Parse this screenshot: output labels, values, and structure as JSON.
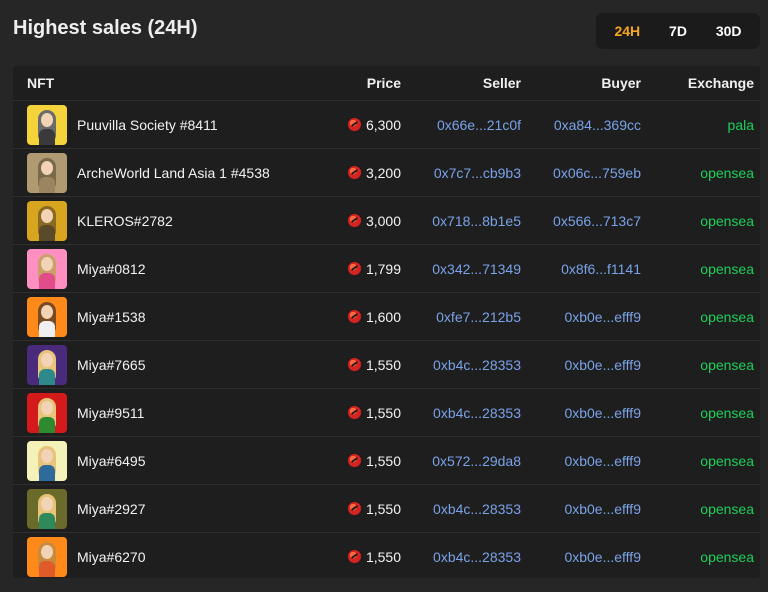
{
  "header": {
    "title": "Highest sales (24H)",
    "tabs": [
      {
        "label": "24H",
        "active": true
      },
      {
        "label": "7D",
        "active": false
      },
      {
        "label": "30D",
        "active": false
      }
    ]
  },
  "table": {
    "columns": [
      "NFT",
      "Price",
      "Seller",
      "Buyer",
      "Exchange"
    ],
    "rows": [
      {
        "nft": "Puuvilla Society #8411",
        "price": "6,300",
        "seller": "0x66e...21c0f",
        "buyer": "0xa84...369cc",
        "exchange": "pala"
      },
      {
        "nft": "ArcheWorld Land Asia 1 #4538",
        "price": "3,200",
        "seller": "0x7c7...cb9b3",
        "buyer": "0x06c...759eb",
        "exchange": "opensea"
      },
      {
        "nft": "KLEROS#2782",
        "price": "3,000",
        "seller": "0x718...8b1e5",
        "buyer": "0x566...713c7",
        "exchange": "opensea"
      },
      {
        "nft": "Miya#0812",
        "price": "1,799",
        "seller": "0x342...71349",
        "buyer": "0x8f6...f1141",
        "exchange": "opensea"
      },
      {
        "nft": "Miya#1538",
        "price": "1,600",
        "seller": "0xfe7...212b5",
        "buyer": "0xb0e...efff9",
        "exchange": "opensea"
      },
      {
        "nft": "Miya#7665",
        "price": "1,550",
        "seller": "0xb4c...28353",
        "buyer": "0xb0e...efff9",
        "exchange": "opensea"
      },
      {
        "nft": "Miya#9511",
        "price": "1,550",
        "seller": "0xb4c...28353",
        "buyer": "0xb0e...efff9",
        "exchange": "opensea"
      },
      {
        "nft": "Miya#6495",
        "price": "1,550",
        "seller": "0x572...29da8",
        "buyer": "0xb0e...efff9",
        "exchange": "opensea"
      },
      {
        "nft": "Miya#2927",
        "price": "1,550",
        "seller": "0xb4c...28353",
        "buyer": "0xb0e...efff9",
        "exchange": "opensea"
      },
      {
        "nft": "Miya#6270",
        "price": "1,550",
        "seller": "0xb4c...28353",
        "buyer": "0xb0e...efff9",
        "exchange": "opensea"
      }
    ]
  },
  "colors": {
    "active_tab": "#f6a623",
    "address": "#7aa2e8",
    "exchange": "#1fcf5c",
    "thumbs": [
      {
        "bg": "#f5d33a",
        "hair": "#6b6b6b",
        "body": "#3a3a3a"
      },
      {
        "bg": "#b09a72",
        "hair": "#7a6a4c",
        "body": "#9b8560"
      },
      {
        "bg": "#d8a520",
        "hair": "#8a6a20",
        "body": "#5a4a2a"
      },
      {
        "bg": "#ff8fc1",
        "hair": "#c9a06a",
        "body": "#e04d8a"
      },
      {
        "bg": "#ff8a1a",
        "hair": "#7a4a22",
        "body": "#f0f0f0"
      },
      {
        "bg": "#4a2a7a",
        "hair": "#e7c47a",
        "body": "#2e8a8a"
      },
      {
        "bg": "#d41a1a",
        "hair": "#e7c47a",
        "body": "#2e8a2e"
      },
      {
        "bg": "#f4f2b8",
        "hair": "#e7c47a",
        "body": "#2e6a9a"
      },
      {
        "bg": "#6a6a2a",
        "hair": "#e7c47a",
        "body": "#2e8a5a"
      },
      {
        "bg": "#ff8a1a",
        "hair": "#c98a3a",
        "body": "#e05a2a"
      }
    ]
  }
}
